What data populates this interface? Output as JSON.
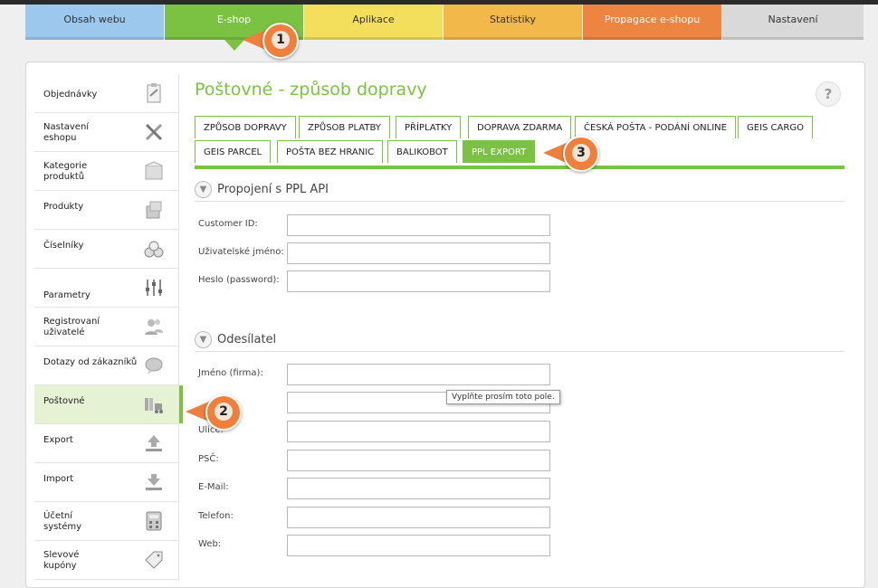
{
  "top_nav": {
    "tabs": [
      {
        "label": "Obsah webu",
        "color": "#9cc8ee"
      },
      {
        "label": "E-shop",
        "color": "#7bc142"
      },
      {
        "label": "Aplikace",
        "color": "#f3df5b"
      },
      {
        "label": "Statistiky",
        "color": "#f3b84a"
      },
      {
        "label": "Propagace e-shopu",
        "color": "#ec8542"
      },
      {
        "label": "Nastavení",
        "color": "#d9d9d9"
      }
    ]
  },
  "sidebar": {
    "items": [
      {
        "label": "Objednávky",
        "icon": "clipboard-icon"
      },
      {
        "label": "Nastavení\neshopu",
        "icon": "tools-icon"
      },
      {
        "label": "Kategorie\nproduktů",
        "icon": "box-open-icon"
      },
      {
        "label": "Produkty",
        "icon": "boxes-icon"
      },
      {
        "label": "Číselníky",
        "icon": "coins-icon"
      },
      {
        "label": "Parametry",
        "icon": "sliders-icon"
      },
      {
        "label": "Registrovaní\nuživatelé",
        "icon": "users-icon"
      },
      {
        "label": "Dotazy od zákazníků",
        "icon": "chat-icon"
      },
      {
        "label": "Poštovné",
        "icon": "delivery-truck-icon"
      },
      {
        "label": "Export",
        "icon": "export-icon"
      },
      {
        "label": "Import",
        "icon": "import-icon"
      },
      {
        "label": "Účetní\nsystémy",
        "icon": "calculator-icon"
      },
      {
        "label": "Slevové\nkupóny",
        "icon": "coupon-tag-icon"
      }
    ]
  },
  "page": {
    "title": "Poštovné - způsob dopravy",
    "help_label": "?",
    "tabs": [
      "ZPŮSOB DOPRAVY",
      "ZPŮSOB PLATBY",
      "PŘÍPLATKY",
      "DOPRAVA ZDARMA",
      "ČESKÁ POŠTA - PODÁNÍ ONLINE",
      "GEIS CARGO",
      "GEIS PARCEL",
      "POŠTA BEZ HRANIC",
      "BALIKOBOT",
      "PPL EXPORT"
    ],
    "active_tab": "PPL EXPORT",
    "accent_color": "#7bc142"
  },
  "sections": [
    {
      "title": "Propojení s PPL API",
      "fields": [
        {
          "label": "Customer ID:",
          "value": ""
        },
        {
          "label": "Uživatelské jméno:",
          "value": ""
        },
        {
          "label": "Heslo (password):",
          "value": ""
        }
      ]
    },
    {
      "title": "Odesílatel",
      "fields": [
        {
          "label": "Jméno (firma):",
          "value": ""
        },
        {
          "label": "",
          "value": ""
        },
        {
          "label": "Ulice:",
          "value": ""
        },
        {
          "label": "PSČ:",
          "value": ""
        },
        {
          "label": "E-Mail:",
          "value": ""
        },
        {
          "label": "Telefon:",
          "value": ""
        },
        {
          "label": "Web:",
          "value": ""
        }
      ]
    }
  ],
  "tooltip": "Vyplňte prosím toto pole.",
  "callouts": [
    "1",
    "2",
    "3"
  ],
  "callout_color": "#f07f3c"
}
